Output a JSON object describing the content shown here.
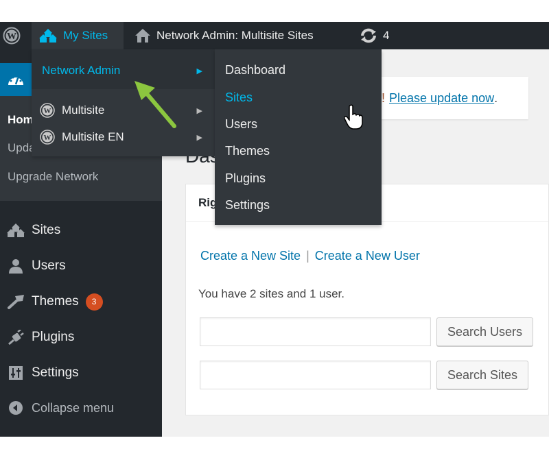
{
  "adminbar": {
    "wp_logo": "wordpress-logo-icon",
    "my_sites": "My Sites",
    "network_title": "Network Admin: Multisite Sites",
    "updates_count": "4",
    "colors": {
      "bg": "#23282d",
      "highlight": "#00b9eb"
    }
  },
  "my_sites_menu": {
    "items": [
      {
        "label": "Network Admin",
        "active": true
      },
      {
        "label": "Multisite",
        "active": false
      },
      {
        "label": "Multisite EN",
        "active": false
      }
    ]
  },
  "network_admin_submenu": {
    "items": [
      {
        "label": "Dashboard"
      },
      {
        "label": "Sites",
        "active": true
      },
      {
        "label": "Users"
      },
      {
        "label": "Themes"
      },
      {
        "label": "Plugins"
      },
      {
        "label": "Settings"
      }
    ]
  },
  "sidebar": {
    "dashboard_submenu": [
      {
        "label": "Home",
        "current": true
      },
      {
        "label": "Updates"
      },
      {
        "label": "Upgrade Network"
      }
    ],
    "items": [
      {
        "label": "Sites",
        "icon": "sites-icon"
      },
      {
        "label": "Users",
        "icon": "users-icon"
      },
      {
        "label": "Themes",
        "icon": "themes-icon",
        "badge": "3"
      },
      {
        "label": "Plugins",
        "icon": "plugins-icon"
      },
      {
        "label": "Settings",
        "icon": "settings-icon"
      }
    ],
    "collapse": "Collapse menu",
    "colors": {
      "bg": "#23282d",
      "active": "#0073aa",
      "badge": "#d54e21"
    }
  },
  "main": {
    "notice_suffix": "!",
    "notice_link": "Please update now",
    "notice_end": ".",
    "page_title": "Dashboard",
    "panel_title": "Right Now",
    "create_site": "Create a New Site",
    "separator": "|",
    "create_user": "Create a New User",
    "summary": "You have 2 sites and 1 user.",
    "search_users_value": "",
    "search_users_button": "Search Users",
    "search_sites_value": "",
    "search_sites_button": "Search Sites"
  }
}
